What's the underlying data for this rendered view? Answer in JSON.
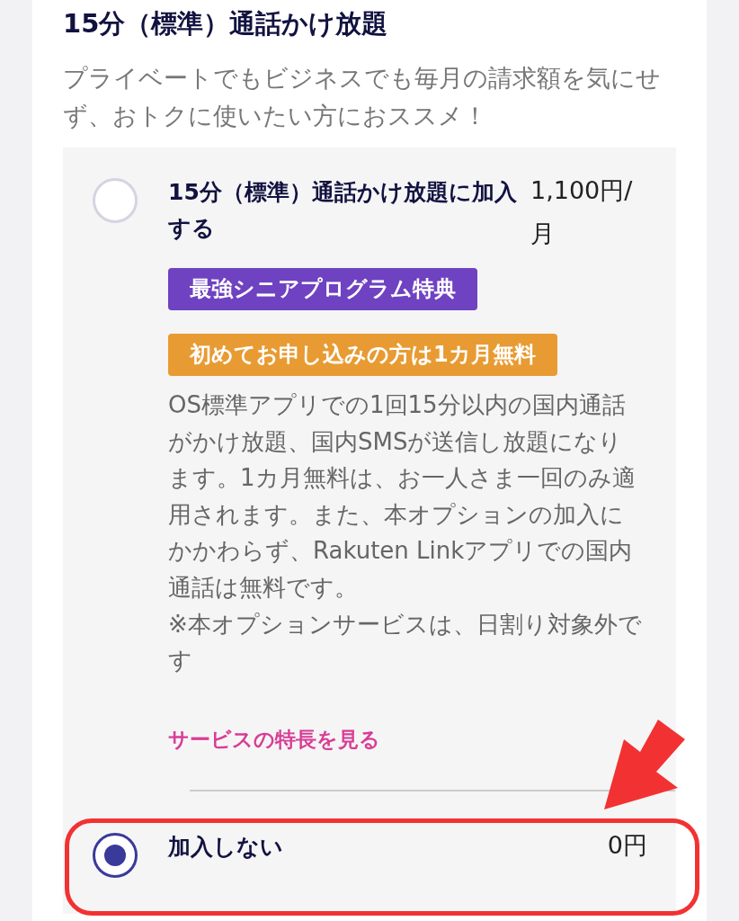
{
  "section": {
    "title": "15分（標準）通話かけ放題",
    "description": "プライベートでもビジネスでも毎月の請求額を気にせず、おトクに使いたい方におススメ！"
  },
  "options": [
    {
      "label": "15分（標準）通話かけ放題に加入する",
      "price": "1,100円/月",
      "selected": false,
      "badges": [
        {
          "text": "最強シニアプログラム特典",
          "color": "#6f42c1"
        },
        {
          "text": "初めてお申し込みの方は1カ月無料",
          "color": "#e89b32"
        }
      ],
      "description": "OS標準アプリでの1回15分以内の国内通話がかけ放題、国内SMSが送信し放題になります。1カ月無料は、お一人さま一回のみ適用されます。また、本オプションの加入にかかわらず、Rakuten Linkアプリでの国内通話は無料です。\n※本オプションサービスは、日割り対象外です",
      "link": "サービスの特長を見る"
    },
    {
      "label": "加入しない",
      "price": "0円",
      "selected": true
    }
  ]
}
